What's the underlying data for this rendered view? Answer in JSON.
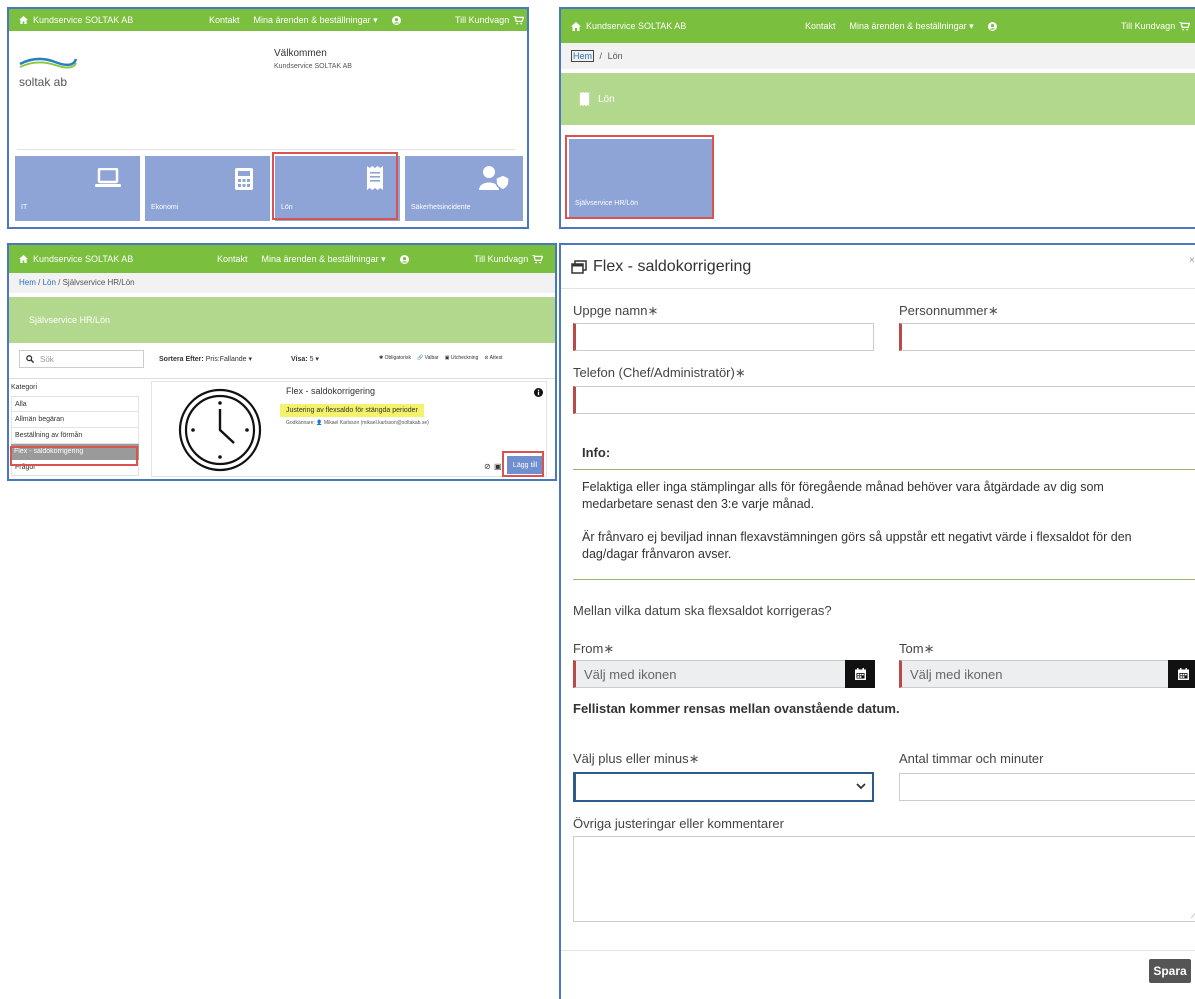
{
  "topbar": {
    "brand": "Kundservice SOLTAK AB",
    "contact": "Kontakt",
    "orders": "Mina ärenden & beställningar",
    "cart": "Till Kundvagn",
    "color": "#7bbf3e"
  },
  "home": {
    "logo_text": "soltak ab",
    "welcome_title": "Välkommen",
    "welcome_sub": "Kundservice SOLTAK AB",
    "tiles": [
      {
        "label": "IT",
        "icon": "laptop-icon"
      },
      {
        "label": "Ekonomi",
        "icon": "calculator-icon"
      },
      {
        "label": "Lön",
        "icon": "receipt-icon"
      },
      {
        "label": "Säkerhetsincidente",
        "icon": "user-shield-icon"
      }
    ]
  },
  "lon": {
    "breadcrumb_home": "Hem",
    "breadcrumb_sep": "/",
    "breadcrumb_current": "Lön",
    "banner": "Lön",
    "tile": "Självservice HR/Lön"
  },
  "catalog": {
    "breadcrumb": [
      "Hem",
      "Lön",
      "Självservice HR/Lön"
    ],
    "banner": "Självservice HR/Lön",
    "search_placeholder": "Sök",
    "sort_label": "Sortera Efter:",
    "sort_value": "Pris:Fallande",
    "show_label": "Visa:",
    "show_value": "5",
    "legend": [
      "Obligatorisk",
      "Valbar",
      "Utcheckning",
      "Attest"
    ],
    "category_header": "Kategori",
    "categories": [
      "Alla",
      "Allmän begäran",
      "Beställning av förmån",
      "Flex - saldokorrigering",
      "Frågor"
    ],
    "item_title": "Flex - saldokorrigering",
    "item_desc": "Justering av flexsaldo för stängda perioder",
    "approver_label": "Godkännare:",
    "approver": "Mikael Karlsson (mikael.karlsson@soltakab.se)",
    "add_button": "Lägg till"
  },
  "form": {
    "title": "Flex - saldokorrigering",
    "name_label": "Uppge namn",
    "pnr_label": "Personnummer",
    "phone_label": "Telefon (Chef/Administratör)",
    "info_title": "Info:",
    "info_p1": "Felaktiga eller inga stämplingar alls för föregående månad behöver vara åtgärdade av dig som medarbetare senast den 3:e varje månad.",
    "info_p2": "Är frånvaro ej beviljad innan flexavstämningen görs så uppstår ett negativt värde i flexsaldot för den dag/dagar frånvaron avser.",
    "question": "Mellan vilka datum ska flexsaldot korrigeras?",
    "from_label": "From",
    "tom_label": "Tom",
    "date_placeholder": "Välj med ikonen",
    "note": "Fellistan kommer rensas mellan ovanstående datum.",
    "plusminus_label": "Välj plus eller minus",
    "hours_label": "Antal timmar och minuter",
    "comments_label": "Övriga justeringar eller kommentarer",
    "save_button": "Spara",
    "required_mark": "∗"
  }
}
